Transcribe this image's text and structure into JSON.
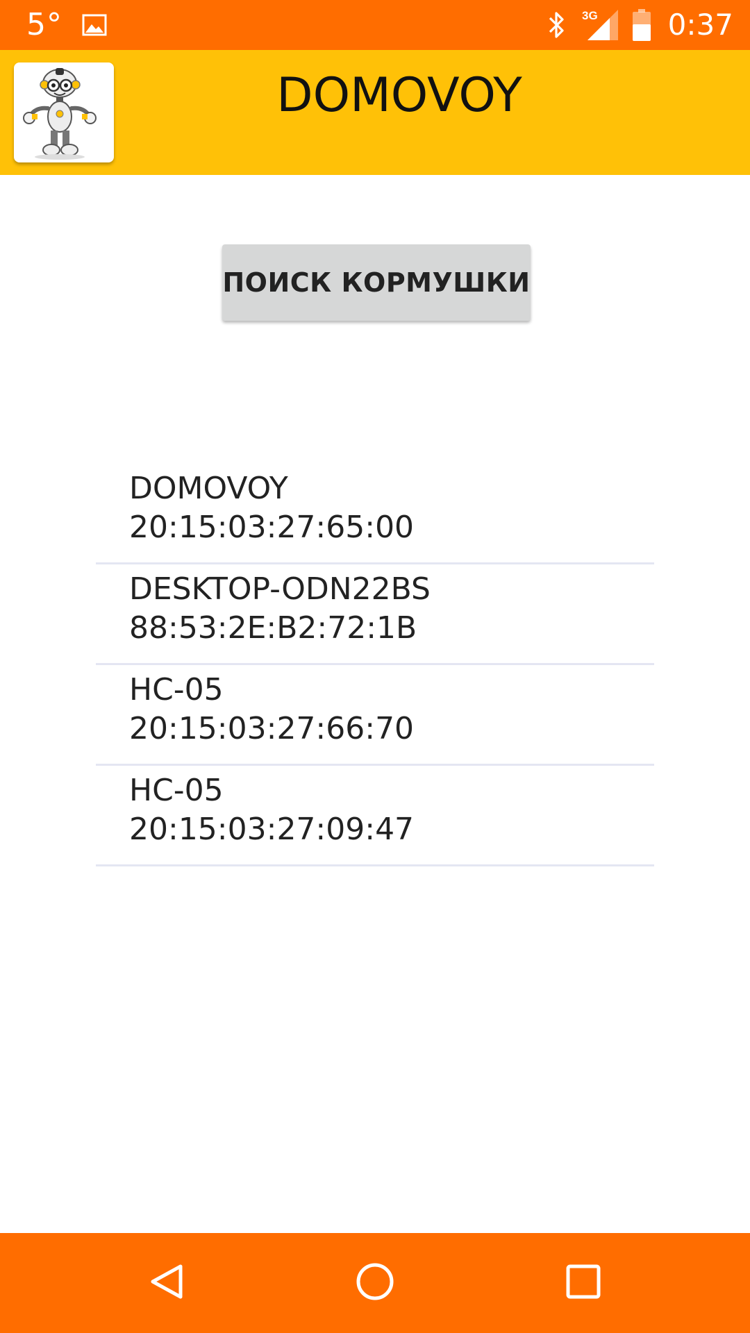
{
  "status_bar": {
    "temperature": "5°",
    "network_type": "3G",
    "time": "0:37",
    "icons": [
      "image-icon",
      "bluetooth-icon",
      "signal-icon",
      "battery-icon"
    ]
  },
  "app_bar": {
    "title": "DOMOVOY",
    "logo_icon": "robot-logo-icon"
  },
  "search_button": {
    "label": "ПОИСК КОРМУШКИ"
  },
  "devices": [
    {
      "name": "DOMOVOY",
      "address": "20:15:03:27:65:00"
    },
    {
      "name": "DESKTOP-ODN22BS",
      "address": "88:53:2E:B2:72:1B"
    },
    {
      "name": "HC-05",
      "address": "20:15:03:27:66:70"
    },
    {
      "name": "HC-05",
      "address": "20:15:03:27:09:47"
    }
  ],
  "nav_bar": {
    "icons": [
      "back-icon",
      "home-icon",
      "recents-icon"
    ]
  },
  "colors": {
    "status_bar": "#ff6d00",
    "app_bar": "#ffc107",
    "nav_bar": "#ff6d00",
    "button": "#d6d7d7",
    "divider": "#e4e6f2"
  }
}
